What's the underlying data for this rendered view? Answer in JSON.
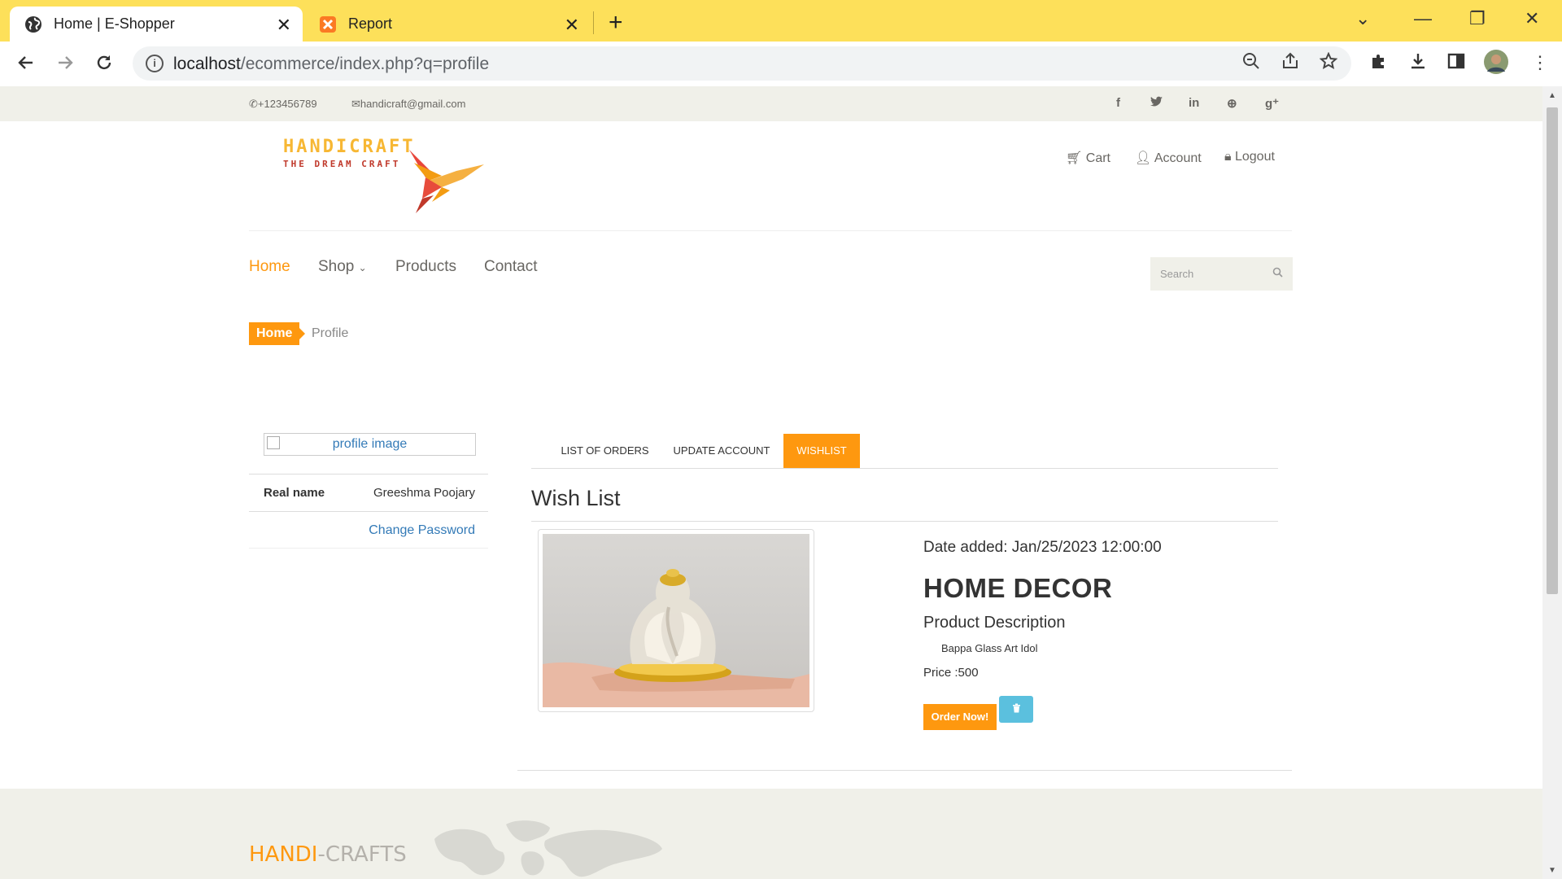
{
  "browser": {
    "tabs": [
      {
        "title": "Home | E-Shopper",
        "active": true
      },
      {
        "title": "Report",
        "active": false
      }
    ],
    "url_host": "localhost",
    "url_path": "/ecommerce/index.php?q=profile"
  },
  "topbar": {
    "phone": "+123456789",
    "email": "handicraft@gmail.com"
  },
  "logo": {
    "line1": "HANDICRAFT",
    "line2": "THE DREAM CRAFT"
  },
  "usermenu": {
    "cart": "Cart",
    "account": "Account",
    "logout": "Logout"
  },
  "nav": {
    "home": "Home",
    "shop": "Shop",
    "products": "Products",
    "contact": "Contact",
    "search_placeholder": "Search"
  },
  "breadcrumb": {
    "home": "Home",
    "current": "Profile"
  },
  "profile": {
    "image_alt": "profile image",
    "real_name_label": "Real name",
    "real_name": "Greeshma Poojary",
    "change_password": "Change Password"
  },
  "profile_tabs": [
    "LIST OF ORDERS",
    "UPDATE ACCOUNT",
    "WISHLIST"
  ],
  "wishlist": {
    "title": "Wish List",
    "date_added": "Date added: Jan/25/2023 12:00:00",
    "category": "HOME DECOR",
    "desc_heading": "Product Description",
    "description": "Bappa Glass Art Idol",
    "price": "Price :500",
    "order_button": "Order Now!"
  },
  "footer": {
    "brand_accent": "HANDI",
    "brand_rest": "-CRAFTS"
  },
  "colors": {
    "accent": "#fe980f",
    "chrome": "#fde05a",
    "link": "#337ab7",
    "info_button": "#5bc0de"
  }
}
